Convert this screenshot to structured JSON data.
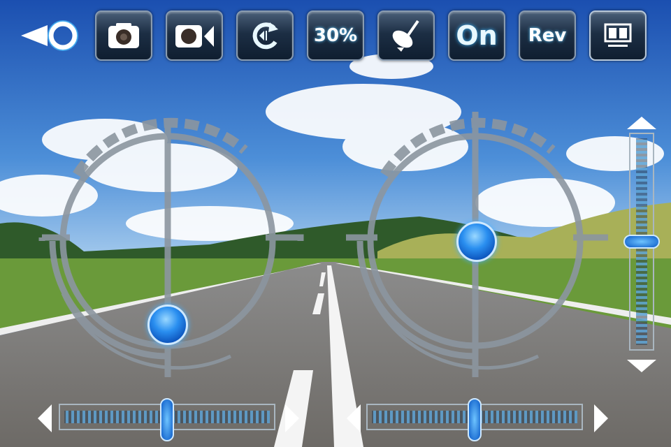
{
  "toolbar": {
    "back": {
      "icon": "back-eye-icon"
    },
    "buttons": [
      {
        "name": "photo-button",
        "icon": "camera-icon"
      },
      {
        "name": "video-button",
        "icon": "video-camera-icon"
      },
      {
        "name": "rotate-button",
        "icon": "rotate-icon"
      },
      {
        "name": "speed-button",
        "label": "30%"
      },
      {
        "name": "gyro-calibrate-button",
        "icon": "gyro-icon"
      },
      {
        "name": "power-toggle-button",
        "label": "On"
      },
      {
        "name": "reverse-button",
        "label": "Rev"
      },
      {
        "name": "split-view-button",
        "icon": "split-screen-icon"
      }
    ]
  },
  "controls": {
    "left_stick": {
      "x": 0,
      "y": -1
    },
    "right_stick": {
      "x": 0,
      "y": 0
    },
    "throttle_trim_percent": 50,
    "left_trim_percent": 50,
    "right_trim_percent": 50
  },
  "colors": {
    "accent": "#2a8ff0",
    "ring": "#8c96a0"
  }
}
